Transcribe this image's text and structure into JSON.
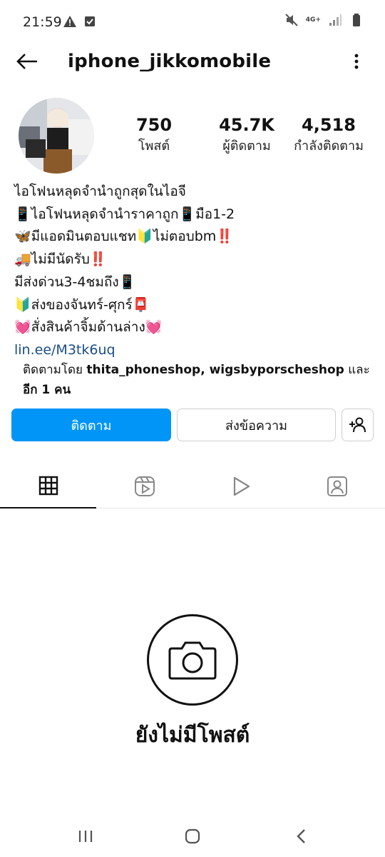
{
  "status_bar": {
    "time": "21:59",
    "network": "4G+"
  },
  "header": {
    "username": "iphone_jikkomobile"
  },
  "stats": {
    "posts_value": "750",
    "posts_label": "โพสต์",
    "followers_value": "45.7K",
    "followers_label": "ผู้ติดตาม",
    "following_value": "4,518",
    "following_label": "กำลังติดตาม"
  },
  "bio": {
    "lines": [
      "ไอโฟนหลุดจำนำถูกสุดในไอจี",
      "📱ไอโฟนหลุดจำนำราคาถูก📱มือ1-2",
      "🦋มีแอดมินตอบแชท🔰ไม่ตอบbm‼️",
      "🚚ไม่มีนัดรับ‼️",
      "มีส่งด่วน3-4ชมถึง📱",
      "🔰ส่งของจันทร์-ศุกร์📮",
      "💓สั่งสินค้าจิ้มด้านล่าง💓"
    ],
    "link": "lin.ee/M3tk6uq"
  },
  "followed_by": {
    "prefix": "ติดตามโดย ",
    "names": "thita_phoneshop, wigsbyporscheshop",
    "conjunction": " และ",
    "others": "อีก 1 คน"
  },
  "actions": {
    "follow_label": "ติดตาม",
    "message_label": "ส่งข้อความ"
  },
  "tabs": {
    "active": "grid"
  },
  "empty_state": {
    "text": "ยังไม่มีโพสต์"
  },
  "colors": {
    "accent": "#0095f6",
    "link": "#1a4d89"
  },
  "icons": [
    "back-arrow-icon",
    "more-vertical-icon",
    "add-person-icon",
    "grid-icon",
    "reels-icon",
    "play-icon",
    "tagged-icon",
    "camera-icon",
    "recent-apps-icon",
    "home-icon",
    "nav-back-icon"
  ]
}
